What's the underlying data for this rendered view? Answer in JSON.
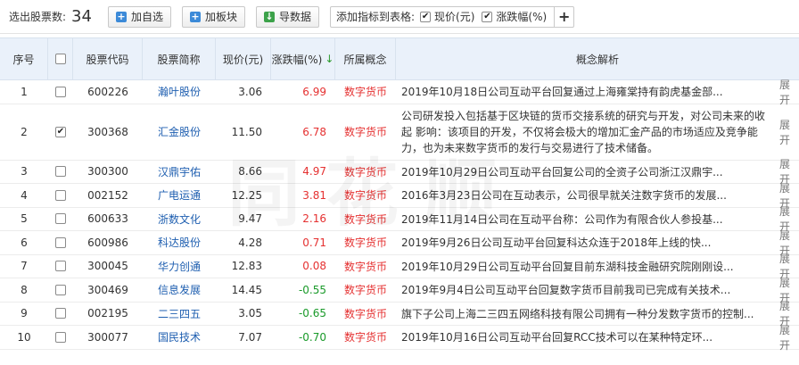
{
  "toolbar": {
    "count_label": "选出股票数:",
    "count_value": "34",
    "add_watchlist": "加自选",
    "add_block": "加板块",
    "export": "导数据",
    "indicator_label": "添加指标到表格:",
    "indicator_price": "现价(元)",
    "indicator_change": "涨跌幅(%)",
    "add_more": "+"
  },
  "headers": {
    "no": "序号",
    "code": "股票代码",
    "name": "股票简称",
    "price": "现价(元)",
    "change": "涨跌幅(%)",
    "concept": "所属概念",
    "desc": "概念解析"
  },
  "sort_arrow": "↓",
  "expand_label": "展开",
  "watermark": "同花顺",
  "rows": [
    {
      "no": "1",
      "checked": false,
      "code": "600226",
      "name": "瀚叶股份",
      "price": "3.06",
      "change": "6.99",
      "dir": "up",
      "concept": "数字货币",
      "desc": "2019年10月18日公司互动平台回复通过上海雍棠持有韵虎基金部..."
    },
    {
      "no": "2",
      "checked": true,
      "code": "300368",
      "name": "汇金股份",
      "price": "11.50",
      "change": "6.78",
      "dir": "up",
      "concept": "数字货币",
      "desc": "公司研发投入包括基于区块链的货币交接系统的研究与开发，对公司未来的收起 影响：该项目的开发，不仅将会极大的增加汇金产品的市场适应及竞争能力，也为未来数字货币的发行与交易进行了技术储备。",
      "multi": true
    },
    {
      "no": "3",
      "checked": false,
      "code": "300300",
      "name": "汉鼎宇佑",
      "price": "8.66",
      "change": "4.97",
      "dir": "up",
      "concept": "数字货币",
      "desc": "2019年10月29日公司互动平台回复公司的全资子公司浙江汉鼎宇..."
    },
    {
      "no": "4",
      "checked": false,
      "code": "002152",
      "name": "广电运通",
      "price": "12.25",
      "change": "3.81",
      "dir": "up",
      "concept": "数字货币",
      "desc": "2016年3月23日公司在互动表示，公司很早就关注数字货币的发展..."
    },
    {
      "no": "5",
      "checked": false,
      "code": "600633",
      "name": "浙数文化",
      "price": "9.47",
      "change": "2.16",
      "dir": "up",
      "concept": "数字货币",
      "desc": "2019年11月14日公司在互动平台称：公司作为有限合伙人参投基..."
    },
    {
      "no": "6",
      "checked": false,
      "code": "600986",
      "name": "科达股份",
      "price": "4.28",
      "change": "0.71",
      "dir": "up",
      "concept": "数字货币",
      "desc": "2019年9月26日公司互动平台回复科达众连于2018年上线的快..."
    },
    {
      "no": "7",
      "checked": false,
      "code": "300045",
      "name": "华力创通",
      "price": "12.83",
      "change": "0.08",
      "dir": "up",
      "concept": "数字货币",
      "desc": "2019年10月29日公司互动平台回复目前东湖科技金融研究院刚刚设..."
    },
    {
      "no": "8",
      "checked": false,
      "code": "300469",
      "name": "信息发展",
      "price": "14.45",
      "change": "-0.55",
      "dir": "down",
      "concept": "数字货币",
      "desc": "2019年9月4日公司互动平台回复数字货币目前我司已完成有关技术..."
    },
    {
      "no": "9",
      "checked": false,
      "code": "002195",
      "name": "二三四五",
      "price": "3.05",
      "change": "-0.65",
      "dir": "down",
      "concept": "数字货币",
      "desc": "旗下子公司上海二三四五网络科技有限公司拥有一种分发数字货币的控制..."
    },
    {
      "no": "10",
      "checked": false,
      "code": "300077",
      "name": "国民技术",
      "price": "7.07",
      "change": "-0.70",
      "dir": "down",
      "concept": "数字货币",
      "desc": "2019年10月16日公司互动平台回复RCC技术可以在某种特定环..."
    }
  ]
}
